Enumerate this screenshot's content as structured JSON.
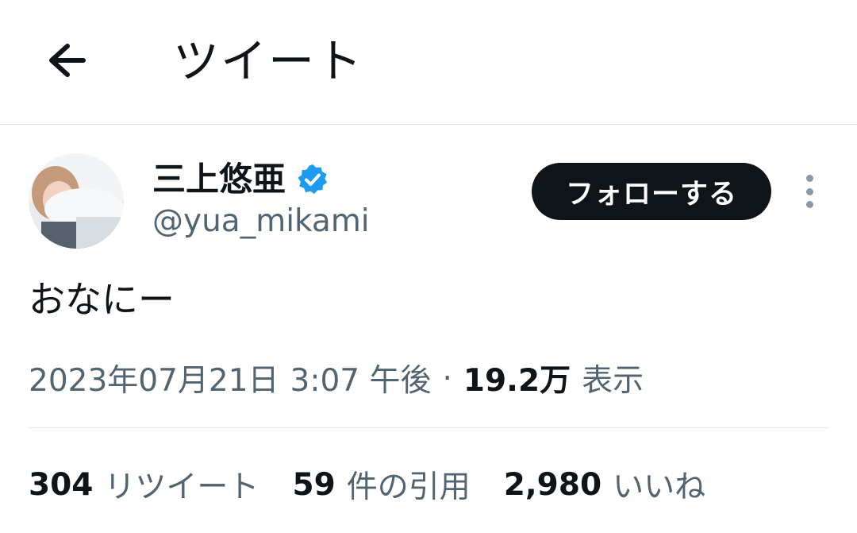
{
  "header": {
    "title": "ツイート",
    "back_icon": "arrow-left-icon"
  },
  "author": {
    "display_name": "三上悠亜",
    "handle": "@yua_mikami",
    "verified": true,
    "verified_color": "#1d9bf0"
  },
  "follow_button": {
    "label": "フォローする"
  },
  "more_icon": "more-vertical-icon",
  "tweet": {
    "text": "おなにー"
  },
  "meta": {
    "date": "2023年07月21日",
    "time": "3:07 午後",
    "separator": "·",
    "views_count": "19.2万",
    "views_label": "表示"
  },
  "stats": {
    "retweets": {
      "count": "304",
      "label": "リツイート"
    },
    "quotes": {
      "count": "59",
      "label": "件の引用"
    },
    "likes": {
      "count": "2,980",
      "label": "いいね"
    }
  },
  "colors": {
    "text_primary": "#0f1419",
    "text_secondary": "#536471",
    "follow_bg": "#0f1419",
    "divider": "#e6e9ec"
  }
}
